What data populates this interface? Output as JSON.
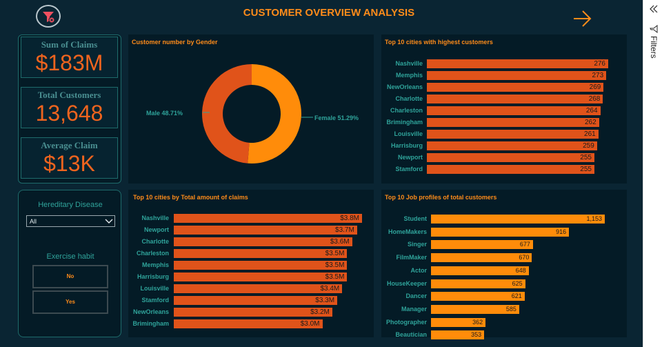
{
  "header": {
    "title": "CUSTOMER OVERVIEW ANALYSIS",
    "filter_icon": "filter-clear-icon",
    "nav_icon": "arrow-right-icon"
  },
  "kpis": [
    {
      "label": "Sum of Claims",
      "value": "$183M"
    },
    {
      "label": "Total Customers",
      "value": "13,648"
    },
    {
      "label": "Average Claim",
      "value": "$13K"
    }
  ],
  "slicers": {
    "hereditary": {
      "label": "Hereditary Disease",
      "selected": "All"
    },
    "exercise": {
      "label": "Exercise habit",
      "options": [
        "No",
        "Yes"
      ]
    }
  },
  "filters_pane": {
    "label": "Filters",
    "collapse_icon": "double-chevron-left-icon",
    "filter_icon": "filter-outline-icon"
  },
  "colors": {
    "accent": "#ff8c1a",
    "bar_red": "#e0531a",
    "bar_orange": "#ff8c0a",
    "teal": "#2fa39a"
  },
  "chart_data": [
    {
      "type": "pie",
      "title": "Customer number by Gender",
      "categories": [
        "Male",
        "Female"
      ],
      "values": [
        48.71,
        51.29
      ],
      "labels": [
        "Male 48.71%",
        "Female 51.29%"
      ],
      "colors": [
        "#e0531a",
        "#ff8c0a"
      ]
    },
    {
      "type": "bar",
      "orientation": "horizontal",
      "title": "Top 10 cities with highest customers",
      "categories": [
        "Nashville",
        "Memphis",
        "NewOrleans",
        "Charlotte",
        "Charleston",
        "Brimingham",
        "Louisville",
        "Harrisburg",
        "Newport",
        "Stamford"
      ],
      "values": [
        276,
        273,
        269,
        268,
        264,
        262,
        261,
        259,
        255,
        255
      ],
      "value_labels": [
        "276",
        "273",
        "269",
        "268",
        "264",
        "262",
        "261",
        "259",
        "255",
        "255"
      ],
      "color": "#e0531a"
    },
    {
      "type": "bar",
      "orientation": "horizontal",
      "title": "Top 10 cities by Total amount of claims",
      "categories": [
        "Nashville",
        "Newport",
        "Charlotte",
        "Charleston",
        "Memphis",
        "Harrisburg",
        "Louisville",
        "Stamford",
        "NewOrleans",
        "Brimingham"
      ],
      "values": [
        3.8,
        3.7,
        3.6,
        3.5,
        3.5,
        3.5,
        3.4,
        3.3,
        3.2,
        3.0
      ],
      "value_labels": [
        "$3.8M",
        "$3.7M",
        "$3.6M",
        "$3.5M",
        "$3.5M",
        "$3.5M",
        "$3.4M",
        "$3.3M",
        "$3.2M",
        "$3.0M"
      ],
      "color": "#e0531a"
    },
    {
      "type": "bar",
      "orientation": "horizontal",
      "title": "Top 10 Job profiles of total customers",
      "categories": [
        "Student",
        "HomeMakers",
        "Singer",
        "FilmMaker",
        "Actor",
        "HouseKeeper",
        "Dancer",
        "Manager",
        "Photographer",
        "Beautician"
      ],
      "values": [
        1153,
        916,
        677,
        670,
        648,
        625,
        621,
        585,
        362,
        353
      ],
      "value_labels": [
        "1,153",
        "916",
        "677",
        "670",
        "648",
        "625",
        "621",
        "585",
        "362",
        "353"
      ],
      "color": "#ff8c0a"
    }
  ]
}
